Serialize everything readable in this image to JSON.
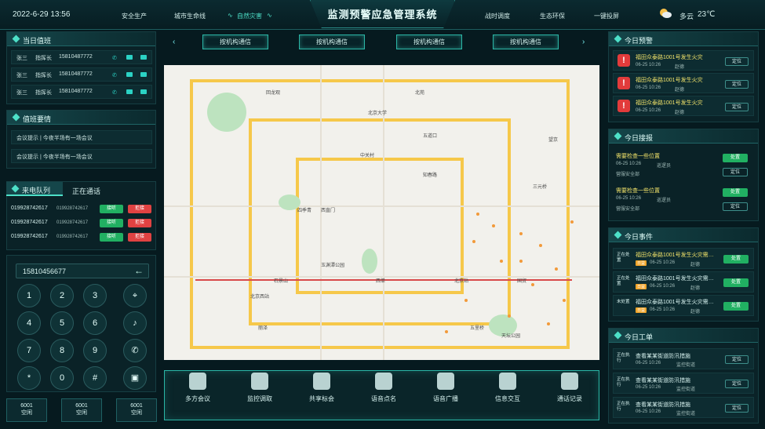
{
  "header": {
    "datetime": "2022-6-29  13:56",
    "nav_left": [
      "安全生产",
      "城市生命线",
      "自然灾害"
    ],
    "title": "监测预警应急管理系统",
    "nav_right": [
      "战时调度",
      "生态环保",
      "一键投屏"
    ],
    "weather_text": "多云",
    "temperature": "23℃"
  },
  "duty": {
    "title": "当日值班",
    "rows": [
      {
        "name": "张三",
        "role": "指挥长",
        "phone": "15810487772"
      },
      {
        "name": "张三",
        "role": "指挥长",
        "phone": "15810487772"
      },
      {
        "name": "张三",
        "role": "指挥长",
        "phone": "15810487772"
      }
    ]
  },
  "duty_notes": {
    "title": "值班要情",
    "items": [
      "会议提示 | 今夜半场有一场会议",
      "会议提示 | 今夜半场有一场会议"
    ]
  },
  "calls": {
    "tab_active": "来电队列",
    "tab_other": "正在通话",
    "rows": [
      {
        "number": "019928742617",
        "sub": "019928742617",
        "accept": "接听",
        "reject": "拒接"
      },
      {
        "number": "019928742617",
        "sub": "019928742617",
        "accept": "接听",
        "reject": "拒接"
      },
      {
        "number": "019928742617",
        "sub": "019928742617",
        "accept": "接听",
        "reject": "拒接"
      }
    ]
  },
  "dialer": {
    "input_value": "15810456677",
    "keys": [
      "1",
      "2",
      "3",
      "4",
      "5",
      "6",
      "7",
      "8",
      "9",
      "*",
      "0",
      "#"
    ]
  },
  "seats": [
    {
      "id": "6001",
      "status": "空闲"
    },
    {
      "id": "6001",
      "status": "空闲"
    },
    {
      "id": "6001",
      "status": "空闲"
    }
  ],
  "tabs": [
    "按机构通信",
    "按机构通信",
    "按机构通信",
    "按机构通信"
  ],
  "toolbar": [
    "多方会议",
    "监控调取",
    "共享标会",
    "语音点名",
    "语音广播",
    "信息交互",
    "通话记录"
  ],
  "map_labels": [
    "五道口",
    "北京大学",
    "中关村",
    "知春路",
    "西直门",
    "四季青",
    "石景山",
    "玉渊潭公园",
    "西单",
    "北京站",
    "天坛公园",
    "国贸",
    "三元桥",
    "北京西站",
    "丽泽",
    "五里桥",
    "望京",
    "北苑",
    "回龙观"
  ],
  "warning": {
    "title": "今日预警",
    "items": [
      {
        "text": "福田众泰路1001号发生火灾",
        "time": "06-25 10:26",
        "person": "赵德",
        "btn": "定位"
      },
      {
        "text": "福田众泰路1001号发生火灾",
        "time": "06-25 10:26",
        "person": "赵德",
        "btn": "定位"
      },
      {
        "text": "福田众泰路1001号发生火灾",
        "time": "06-25 10:26",
        "person": "赵德",
        "btn": "定位"
      }
    ]
  },
  "reports": {
    "title": "今日接报",
    "items": [
      {
        "text": "需要检查一些位置",
        "time": "06-25 10:26",
        "person": "巡逻员",
        "dept": "营服安全部",
        "b1": "处置",
        "b2": "定位"
      },
      {
        "text": "需要检查一些位置",
        "time": "06-25 10:26",
        "person": "巡逻员",
        "dept": "营服安全部",
        "b1": "处置",
        "b2": "定位"
      }
    ]
  },
  "events": {
    "title": "今日事件",
    "items": [
      {
        "status": "正在处置",
        "text": "福田众泰路1001号发生火灾需…",
        "tag": "日益",
        "time": "06-25 10:26",
        "person": "赵德",
        "btn": "处置"
      },
      {
        "status": "正在处置",
        "text": "福田众泰路1001号发生火灾需…",
        "tag": "日益",
        "time": "06-25 10:26",
        "person": "赵德",
        "btn": "处置"
      },
      {
        "status": "未处置",
        "text": "福田众泰路1001号发生火灾需…",
        "tag": "日益",
        "time": "06-25 10:26",
        "person": "赵德",
        "btn": "处置"
      }
    ]
  },
  "orders": {
    "title": "今日工单",
    "items": [
      {
        "status": "正在执行",
        "text": "查看某某街道防汛措施",
        "time": "06-25 10:26",
        "person": "监控街道",
        "btn": "定位"
      },
      {
        "status": "正在执行",
        "text": "查看某某街道防汛措施",
        "time": "06-25 10:26",
        "person": "监控街道",
        "btn": "定位"
      },
      {
        "status": "正在执行",
        "text": "查看某某街道防汛措施",
        "time": "06-25 10:26",
        "person": "监控街道",
        "btn": "定位"
      }
    ]
  }
}
